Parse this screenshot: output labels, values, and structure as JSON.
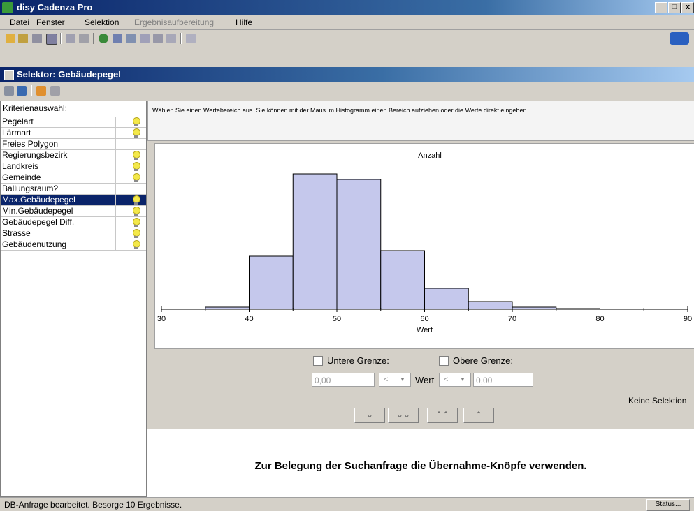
{
  "window": {
    "title": "disy Cadenza Pro",
    "buttons": [
      "_",
      "□",
      "x"
    ]
  },
  "menu": {
    "items": [
      "Datei",
      "Fenster",
      "Selektion",
      "Ergebnisaufbereitung",
      "Hilfe"
    ]
  },
  "selector": {
    "title": "Selektor: Gebäudepegel"
  },
  "criteria": {
    "label": "Kriterienauswahl:",
    "items": [
      {
        "label": "Pegelart",
        "bulb": true
      },
      {
        "label": "Lärmart",
        "bulb": true
      },
      {
        "label": "Freies Polygon",
        "bulb": false
      },
      {
        "label": "Regierungsbezirk",
        "bulb": true
      },
      {
        "label": "Landkreis",
        "bulb": true
      },
      {
        "label": "Gemeinde",
        "bulb": true
      },
      {
        "label": "Ballungsraum?",
        "bulb": false
      },
      {
        "label": "Max.Gebäudepegel",
        "bulb": true,
        "selected": true
      },
      {
        "label": "Min.Gebäudepegel",
        "bulb": true
      },
      {
        "label": "Gebäudepegel Diff.",
        "bulb": true
      },
      {
        "label": "Strasse",
        "bulb": true
      },
      {
        "label": "Gebäudenutzung",
        "bulb": true
      }
    ]
  },
  "info": {
    "text": "Wählen Sie einen Wertebereich aus. Sie können mit der Maus im Histogramm einen Bereich aufziehen oder die Werte direkt eingeben."
  },
  "chart_data": {
    "type": "bar",
    "title": "Anzahl",
    "xlabel": "Wert",
    "ylabel": "",
    "xlim": [
      30,
      90
    ],
    "ylim": [
      0,
      100
    ],
    "xticks": [
      30,
      40,
      50,
      60,
      70,
      80,
      90
    ],
    "bins": [
      {
        "x0": 35,
        "x1": 40,
        "value": 1.5
      },
      {
        "x0": 40,
        "x1": 45,
        "value": 38
      },
      {
        "x0": 45,
        "x1": 50,
        "value": 97
      },
      {
        "x0": 50,
        "x1": 55,
        "value": 93
      },
      {
        "x0": 55,
        "x1": 60,
        "value": 42
      },
      {
        "x0": 60,
        "x1": 65,
        "value": 15
      },
      {
        "x0": 65,
        "x1": 70,
        "value": 5.5
      },
      {
        "x0": 70,
        "x1": 75,
        "value": 1.5
      },
      {
        "x0": 75,
        "x1": 80,
        "value": 0.5
      }
    ],
    "bar_color": "#c5c8ec",
    "grid": false
  },
  "controls": {
    "lower_label": "Untere Grenze:",
    "upper_label": "Obere Grenze:",
    "lower_value": "0,00",
    "upper_value": "0,00",
    "op_left": "<",
    "op_right": "<",
    "wert_label": "Wert",
    "no_selection": "Keine Selektion",
    "nav": [
      "⌄",
      "⌄⌄",
      "⌃⌃",
      "⌃"
    ]
  },
  "hint": {
    "text": "Zur Belegung der Suchanfrage die Übernahme-Knöpfe verwenden."
  },
  "status": {
    "text": "DB-Anfrage bearbeitet. Besorge 10 Ergebnisse.",
    "button": "Status..."
  },
  "colors": {
    "titlebar": "#0a246a",
    "selected_row": "#0a246a",
    "bulb": "#f3e84a"
  }
}
